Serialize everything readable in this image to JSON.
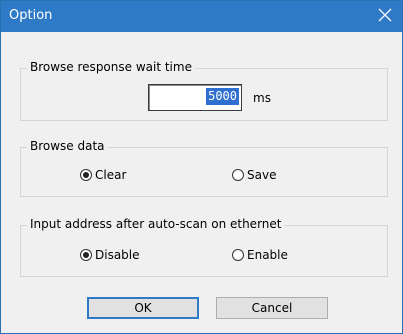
{
  "window": {
    "title": "Option",
    "close_icon": "close-icon"
  },
  "wait_time": {
    "legend": "Browse response wait time",
    "value": "5000",
    "unit": "ms"
  },
  "browse_data": {
    "legend": "Browse data",
    "options": [
      {
        "label": "Clear",
        "checked": true
      },
      {
        "label": "Save",
        "checked": false
      }
    ]
  },
  "input_address": {
    "legend": "Input address after auto-scan on ethernet",
    "options": [
      {
        "label": "Disable",
        "checked": true
      },
      {
        "label": "Enable",
        "checked": false
      }
    ]
  },
  "buttons": {
    "ok": "OK",
    "cancel": "Cancel"
  },
  "colors": {
    "titlebar": "#2f7ac6",
    "selection": "#2f6fd0"
  }
}
